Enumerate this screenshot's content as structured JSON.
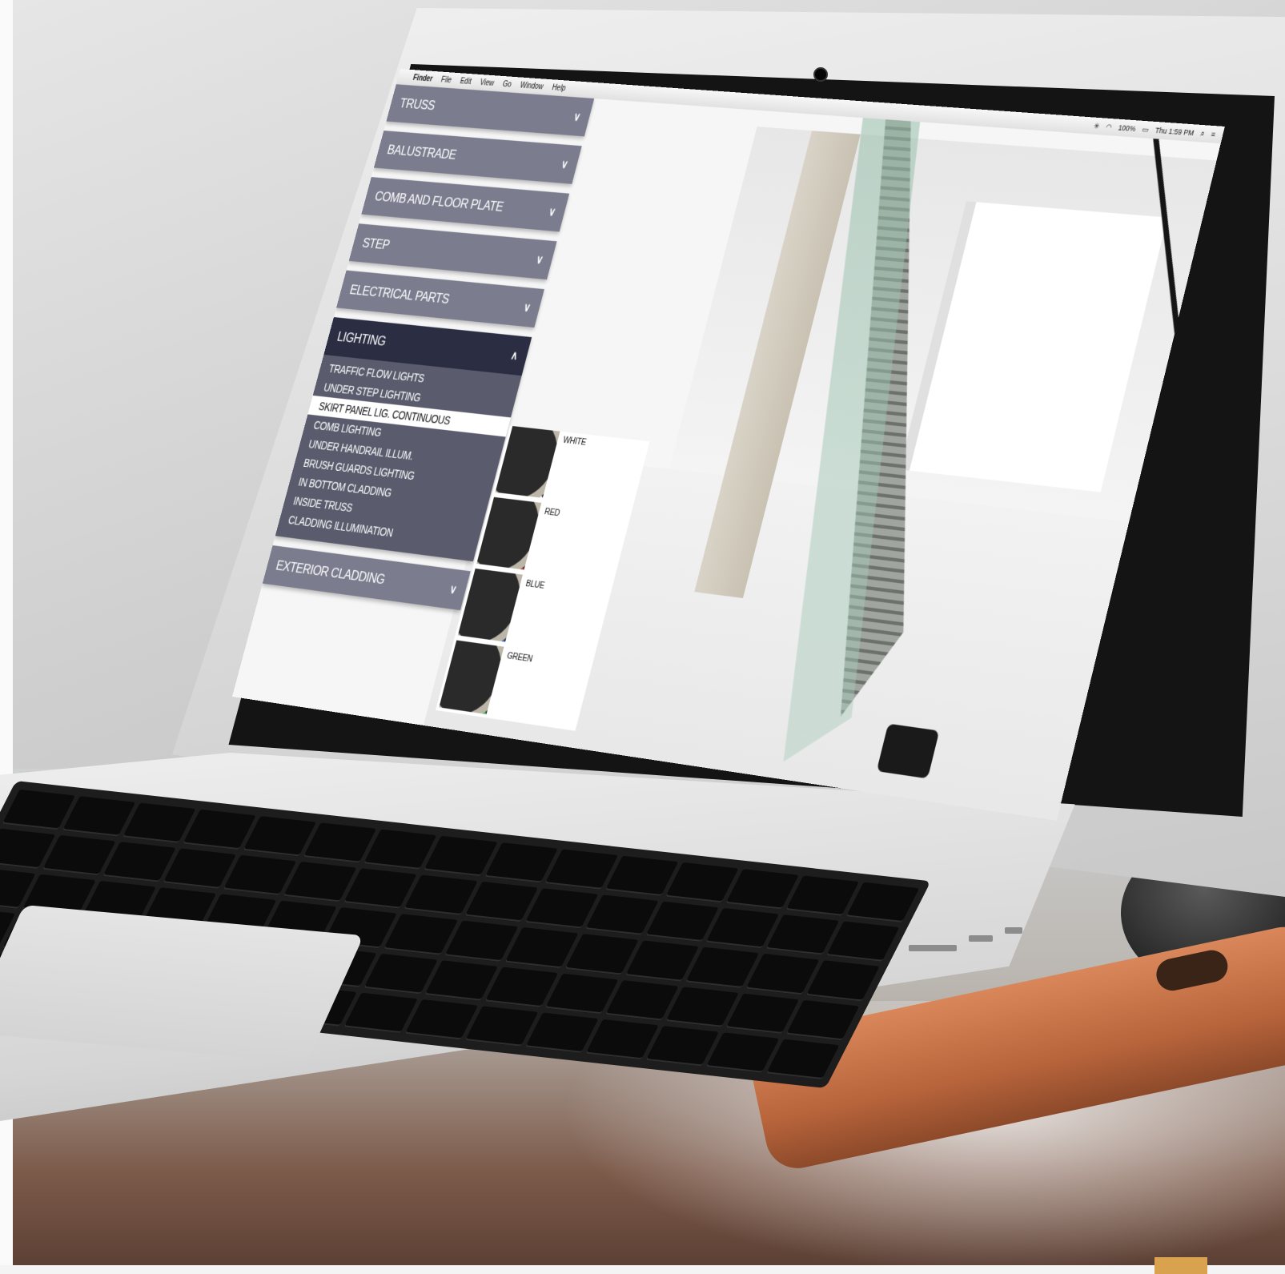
{
  "menubar": {
    "apple_glyph": "",
    "app_name": "Finder",
    "items": [
      "File",
      "Edit",
      "View",
      "Go",
      "Window",
      "Help"
    ],
    "battery": "100%",
    "clock": "Thu 1:59 PM"
  },
  "accordion": {
    "sections": [
      {
        "label": "TRUSS",
        "chevron": "∨"
      },
      {
        "label": "BALUSTRADE",
        "chevron": "∨"
      },
      {
        "label": "COMB AND FLOOR PLATE",
        "chevron": "∨"
      },
      {
        "label": "STEP",
        "chevron": "∨"
      },
      {
        "label": "ELECTRICAL PARTS",
        "chevron": "∨"
      }
    ],
    "open_section": {
      "label": "LIGHTING",
      "chevron": "∧",
      "items": [
        "TRAFFIC FLOW LIGHTS",
        "UNDER STEP LIGHTING",
        "SKIRT PANEL LIG. CONTINUOUS",
        "COMB LIGHTING",
        "UNDER HANDRAIL ILLUM.",
        "BRUSH GUARDS LIGHTING",
        "IN BOTTOM CLADDING",
        "INSIDE TRUSS",
        "CLADDING ILLUMINATION"
      ],
      "active_item": "SKIRT PANEL LIG. CONTINUOUS"
    },
    "last_section": {
      "label": "EXTERIOR CLADDING",
      "chevron": "∨"
    }
  },
  "options": [
    {
      "label": "WHITE",
      "color": "#ffffff"
    },
    {
      "label": "RED",
      "color": "#e33b2e"
    },
    {
      "label": "BLUE",
      "color": "#2f5fe0"
    },
    {
      "label": "GREEN",
      "color": "#3fd650"
    }
  ]
}
